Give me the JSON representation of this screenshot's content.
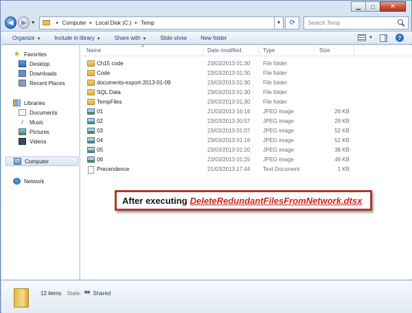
{
  "window": {
    "caption": {
      "minimize_glyph": "▁",
      "maximize_glyph": "□",
      "close_glyph": "✕"
    }
  },
  "address_bar": {
    "segments": [
      "Computer",
      "Local Disk (C:)",
      "Temp"
    ],
    "separator": "▸"
  },
  "search": {
    "placeholder": "Search Temp"
  },
  "toolbar": {
    "items": [
      {
        "label": "Organize",
        "dropdown": true
      },
      {
        "label": "Include in library",
        "dropdown": true
      },
      {
        "label": "Share with",
        "dropdown": true
      },
      {
        "label": "Slide show",
        "dropdown": false
      },
      {
        "label": "New folder",
        "dropdown": false
      }
    ]
  },
  "nav_pane": {
    "favorites": {
      "label": "Favorites",
      "items": [
        "Desktop",
        "Downloads",
        "Recent Places"
      ]
    },
    "libraries": {
      "label": "Libraries",
      "items": [
        "Documents",
        "Music",
        "Pictures",
        "Videos"
      ]
    },
    "computer": {
      "label": "Computer"
    },
    "network": {
      "label": "Network"
    }
  },
  "columns": {
    "name": "Name",
    "date": "Date modified",
    "type": "Type",
    "size": "Size"
  },
  "files": [
    {
      "name": "Ch15 code",
      "date": "23/03/2013 01:30",
      "type": "File folder",
      "size": "",
      "kind": "folder"
    },
    {
      "name": "Code",
      "date": "23/03/2013 01:30",
      "type": "File folder",
      "size": "",
      "kind": "folder"
    },
    {
      "name": "documents-export-2013-01-09",
      "date": "23/03/2013 01:30",
      "type": "File folder",
      "size": "",
      "kind": "folder"
    },
    {
      "name": "SQL Data",
      "date": "23/03/2013 01:30",
      "type": "File folder",
      "size": "",
      "kind": "folder"
    },
    {
      "name": "TempFiles",
      "date": "23/03/2013 01:30",
      "type": "File folder",
      "size": "",
      "kind": "folder"
    },
    {
      "name": "01",
      "date": "21/03/2013 16:16",
      "type": "JPEG image",
      "size": "26 KB",
      "kind": "jpeg"
    },
    {
      "name": "02",
      "date": "23/03/2013 00:57",
      "type": "JPEG image",
      "size": "28 KB",
      "kind": "jpeg"
    },
    {
      "name": "03",
      "date": "23/03/2013 01:07",
      "type": "JPEG image",
      "size": "52 KB",
      "kind": "jpeg"
    },
    {
      "name": "04",
      "date": "23/03/2013 01:16",
      "type": "JPEG image",
      "size": "52 KB",
      "kind": "jpeg"
    },
    {
      "name": "05",
      "date": "23/03/2013 01:20",
      "type": "JPEG image",
      "size": "38 KB",
      "kind": "jpeg"
    },
    {
      "name": "06",
      "date": "23/03/2013 01:25",
      "type": "JPEG image",
      "size": "49 KB",
      "kind": "jpeg"
    },
    {
      "name": "Precendence",
      "date": "21/03/2013 17:44",
      "type": "Text Document",
      "size": "1 KB",
      "kind": "text"
    }
  ],
  "callout": {
    "prefix": "After executing",
    "link": "DeleteRedundantFilesFromNetwork.dtsx"
  },
  "details": {
    "count": "12 items",
    "state_label": "State:",
    "state_value": "Shared"
  }
}
